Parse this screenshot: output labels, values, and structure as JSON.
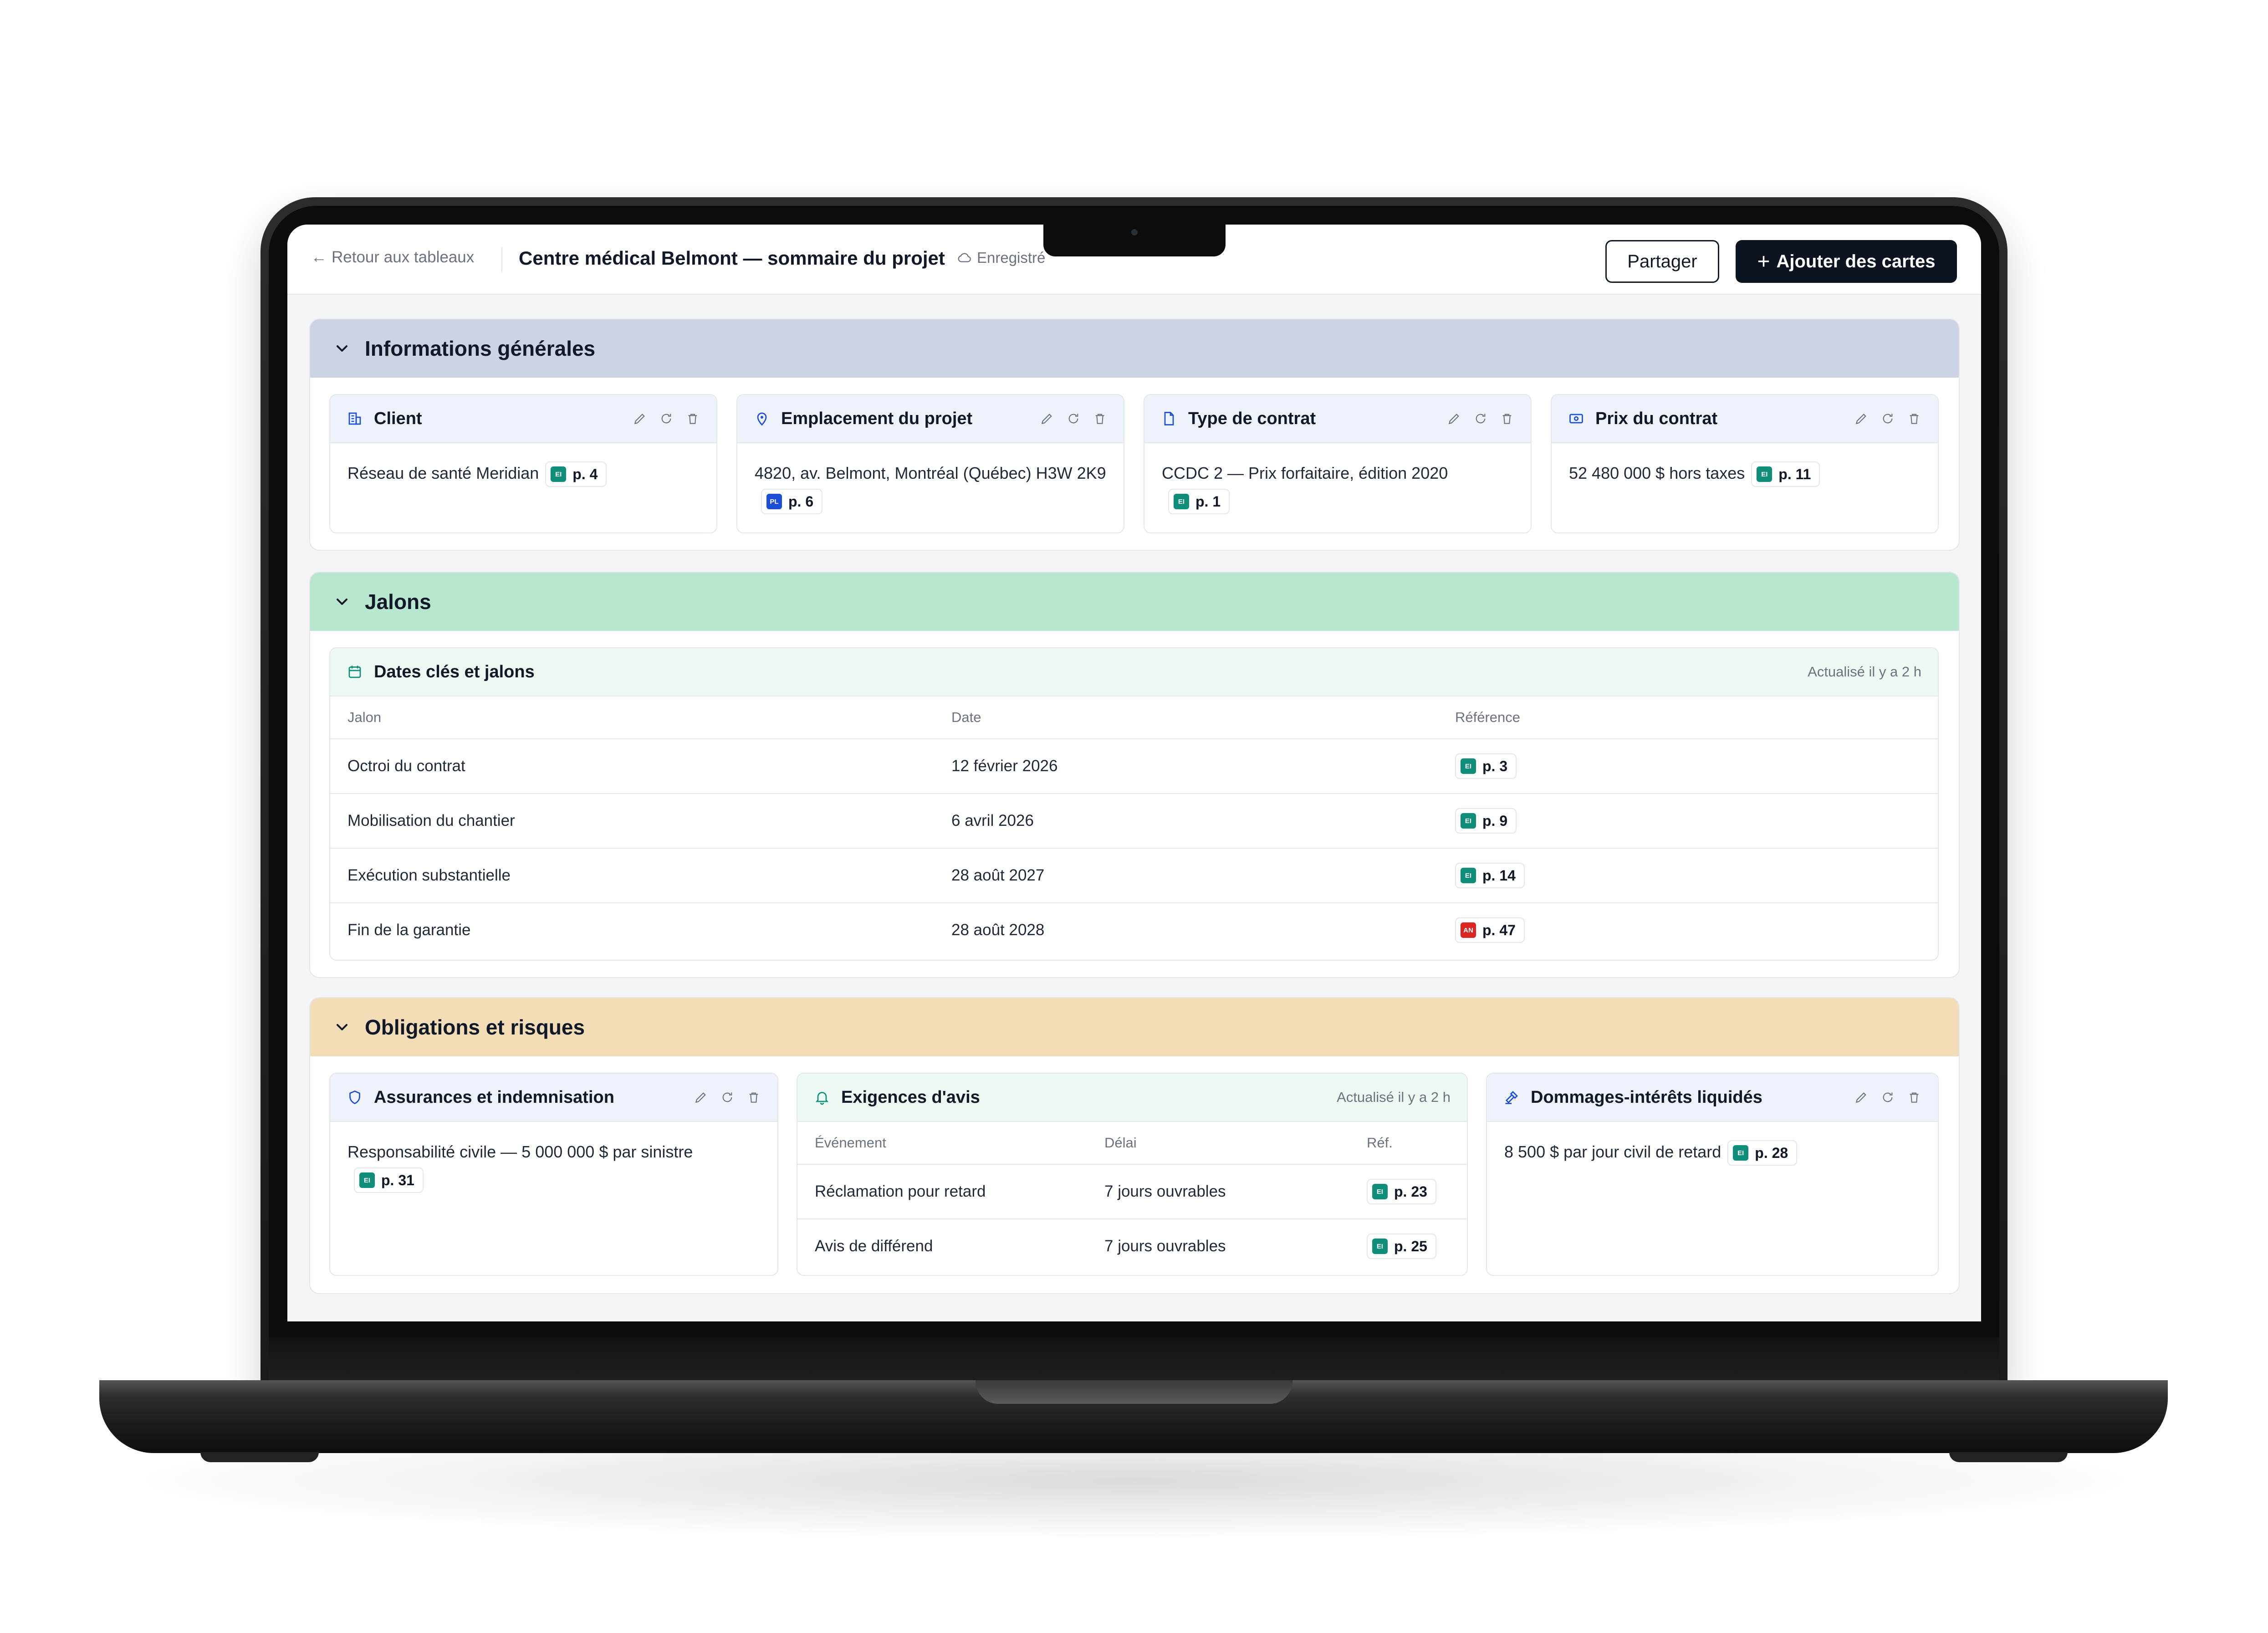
{
  "topbar": {
    "back_label": "Retour aux tableaux",
    "title": "Centre médical Belmont — sommaire du projet",
    "saved_label": "Enregistré",
    "share_label": "Partager",
    "add_label": "Ajouter des cartes"
  },
  "general": {
    "title": "Informations générales",
    "cards": [
      {
        "title": "Client",
        "icon": "building-icon",
        "text": "Réseau de santé Meridian",
        "ref": {
          "badge": "EI",
          "page": "p. 4"
        }
      },
      {
        "title": "Emplacement du projet",
        "icon": "map-pin-icon",
        "text": "4820, av. Belmont, Montréal (Québec) H3W 2K9",
        "ref": {
          "badge": "PL",
          "page": "p. 6"
        }
      },
      {
        "title": "Type de contrat",
        "icon": "document-icon",
        "text": "CCDC 2 — Prix forfaitaire, édition 2020",
        "ref": {
          "badge": "EI",
          "page": "p. 1"
        }
      },
      {
        "title": "Prix du contrat",
        "icon": "banknote-icon",
        "text": "52 480 000 $ hors taxes",
        "ref": {
          "badge": "EI",
          "page": "p. 11"
        }
      }
    ]
  },
  "milestones": {
    "title": "Jalons",
    "card_title": "Dates clés et jalons",
    "updated": "Actualisé il y a 2 h",
    "columns": [
      "Jalon",
      "Date",
      "Référence"
    ],
    "rows": [
      {
        "name": "Octroi du contrat",
        "date": "12 février 2026",
        "badge": "EI",
        "page": "p. 3"
      },
      {
        "name": "Mobilisation du chantier",
        "date": "6 avril 2026",
        "badge": "EI",
        "page": "p. 9"
      },
      {
        "name": "Exécution substantielle",
        "date": "28 août 2027",
        "badge": "EI",
        "page": "p. 14"
      },
      {
        "name": "Fin de la garantie",
        "date": "28 août 2028",
        "badge": "AN",
        "page": "p. 47"
      }
    ]
  },
  "obligations": {
    "title": "Obligations et risques",
    "insurance": {
      "title": "Assurances et indemnisation",
      "text": "Responsabilité civile — 5 000 000 $ par sinistre",
      "ref": {
        "badge": "EI",
        "page": "p. 31"
      }
    },
    "notices": {
      "title": "Exigences d'avis",
      "updated": "Actualisé il y a 2 h",
      "columns": [
        "Événement",
        "Délai",
        "Réf."
      ],
      "rows": [
        {
          "event": "Réclamation pour retard",
          "delay": "7 jours ouvrables",
          "badge": "EI",
          "page": "p. 23"
        },
        {
          "event": "Avis de différend",
          "delay": "7 jours ouvrables",
          "badge": "EI",
          "page": "p. 25"
        }
      ]
    },
    "damages": {
      "title": "Dommages-intérêts liquidés",
      "text": "8 500 $ par jour civil de retard",
      "ref": {
        "badge": "EI",
        "page": "p. 28"
      }
    }
  }
}
